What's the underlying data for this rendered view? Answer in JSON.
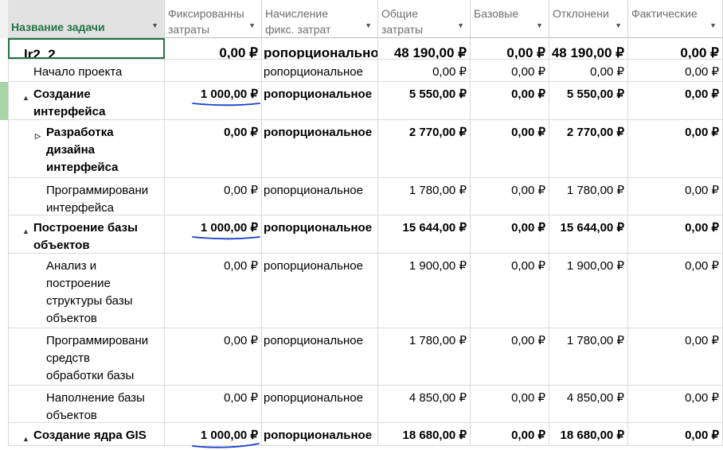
{
  "columns": [
    {
      "label": "Название задачи"
    },
    {
      "label": "Фиксированные затраты",
      "lines": [
        "Фиксированны",
        "затраты"
      ]
    },
    {
      "label": "Начисление фикс. затрат",
      "lines": [
        "Начисление",
        "фикс. затрат"
      ]
    },
    {
      "label": "Общие затраты",
      "lines": [
        "Общие",
        "затраты"
      ]
    },
    {
      "label": "Базовые",
      "lines": [
        "Базовые"
      ]
    },
    {
      "label": "Отклонение",
      "lines": [
        "Отклонени"
      ]
    },
    {
      "label": "Фактические",
      "lines": [
        "Фактические"
      ]
    }
  ],
  "rows": [
    {
      "level": 0,
      "name": "lr2_2",
      "toggle": "▲",
      "bold": true,
      "fixed": "0,00 ₽",
      "accrual": "ропорциональное",
      "total": "48 190,00 ₽",
      "baseline": "0,00 ₽",
      "variance": "48 190,00 ₽",
      "actual": "0,00 ₽"
    },
    {
      "level": 1,
      "name": "Начало проекта",
      "toggle": "",
      "bold": false,
      "fixed": "",
      "accrual": "ропорциональное",
      "total": "0,00 ₽",
      "baseline": "0,00 ₽",
      "variance": "0,00 ₽",
      "actual": "0,00 ₽"
    },
    {
      "level": 1,
      "name": "Создание\nинтерфейса",
      "toggle": "▲",
      "bold": true,
      "fixed": "1 000,00 ₽",
      "accrual": "ропорциональное",
      "total": "5 550,00 ₽",
      "baseline": "0,00 ₽",
      "variance": "5 550,00 ₽",
      "actual": "0,00 ₽",
      "underlined": true,
      "active": true
    },
    {
      "level": 2,
      "name": "Разработка\nдизайна\nинтерфейса",
      "toggle": "▷",
      "bold": true,
      "fixed": "0,00 ₽",
      "accrual": "ропорциональное",
      "total": "2 770,00 ₽",
      "baseline": "0,00 ₽",
      "variance": "2 770,00 ₽",
      "actual": "0,00 ₽"
    },
    {
      "level": 2,
      "name": "Программировани\nинтерфейса",
      "toggle": "",
      "bold": false,
      "fixed": "0,00 ₽",
      "accrual": "ропорциональное",
      "total": "1 780,00 ₽",
      "baseline": "0,00 ₽",
      "variance": "1 780,00 ₽",
      "actual": "0,00 ₽"
    },
    {
      "level": 1,
      "name": "Построение базы\nобъектов",
      "toggle": "▲",
      "bold": true,
      "fixed": "1 000,00 ₽",
      "accrual": "ропорциональное",
      "total": "15 644,00 ₽",
      "baseline": "0,00 ₽",
      "variance": "15 644,00 ₽",
      "actual": "0,00 ₽",
      "underlined": true
    },
    {
      "level": 2,
      "name": "Анализ и\nпостроение\nструктуры базы\nобъектов",
      "toggle": "",
      "bold": false,
      "fixed": "0,00 ₽",
      "accrual": "ропорциональное",
      "total": "1 900,00 ₽",
      "baseline": "0,00 ₽",
      "variance": "1 900,00 ₽",
      "actual": "0,00 ₽"
    },
    {
      "level": 2,
      "name": "Программировани\nсредств\nобработки базы",
      "toggle": "",
      "bold": false,
      "fixed": "0,00 ₽",
      "accrual": "ропорциональное",
      "total": "1 780,00 ₽",
      "baseline": "0,00 ₽",
      "variance": "1 780,00 ₽",
      "actual": "0,00 ₽"
    },
    {
      "level": 2,
      "name": "Наполнение базы\nобъектов",
      "toggle": "",
      "bold": false,
      "fixed": "0,00 ₽",
      "accrual": "ропорциональное",
      "total": "4 850,00 ₽",
      "baseline": "0,00 ₽",
      "variance": "4 850,00 ₽",
      "actual": "0,00 ₽"
    },
    {
      "level": 1,
      "name": "Создание ядра GIS",
      "toggle": "▲",
      "bold": true,
      "fixed": "1 000,00 ₽",
      "accrual": "ропорциональное",
      "total": "18 680,00 ₽",
      "baseline": "0,00 ₽",
      "variance": "18 680,00 ₽",
      "actual": "0,00 ₽",
      "underlined": true
    }
  ],
  "colors": {
    "header_title": "#217346",
    "selected_border": "#217346",
    "active_row_marker": "#a8d5a8",
    "pen": "#1a3fc9"
  }
}
